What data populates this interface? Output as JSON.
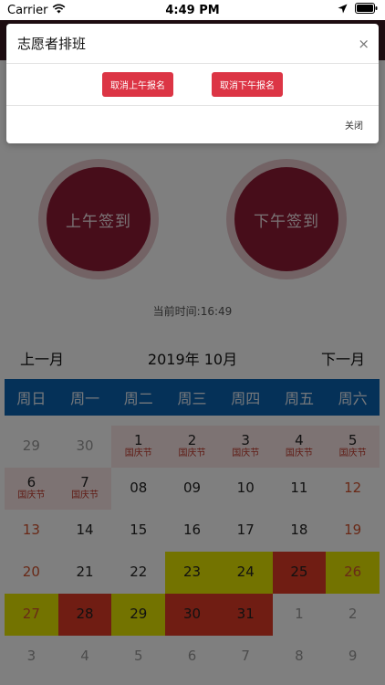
{
  "status_bar": {
    "carrier": "Carrier",
    "time": "4:49 PM"
  },
  "modal": {
    "title": "志愿者排班",
    "close_symbol": "×",
    "cancel_morning": "取消上午报名",
    "cancel_afternoon": "取消下午报名",
    "footer_close": "关闭"
  },
  "page": {
    "morning_sign": "上午签到",
    "afternoon_sign": "下午签到",
    "current_time": "当前时间:16:49",
    "prev_month": "上一月",
    "month_label": "2019年 10月",
    "next_month": "下一月"
  },
  "calendar": {
    "weekdays": [
      "周日",
      "周一",
      "周二",
      "周三",
      "周四",
      "周五",
      "周六"
    ],
    "colors": {
      "weekday_bar": "#0a63b0",
      "yellow": "#e6e600",
      "red": "#e03a26",
      "holiday_bg": "#fae6e6"
    },
    "days": [
      {
        "day": "29",
        "sub": "",
        "type": "other"
      },
      {
        "day": "30",
        "sub": "",
        "type": "other"
      },
      {
        "day": "1",
        "sub": "国庆节",
        "type": "holiday"
      },
      {
        "day": "2",
        "sub": "国庆节",
        "type": "holiday"
      },
      {
        "day": "3",
        "sub": "国庆节",
        "type": "holiday"
      },
      {
        "day": "4",
        "sub": "国庆节",
        "type": "holiday"
      },
      {
        "day": "5",
        "sub": "国庆节",
        "type": "holiday"
      },
      {
        "day": "6",
        "sub": "国庆节",
        "type": "holiday"
      },
      {
        "day": "7",
        "sub": "国庆节",
        "type": "holiday"
      },
      {
        "day": "08",
        "sub": "",
        "type": "normal"
      },
      {
        "day": "09",
        "sub": "",
        "type": "normal"
      },
      {
        "day": "10",
        "sub": "",
        "type": "normal"
      },
      {
        "day": "11",
        "sub": "",
        "type": "normal"
      },
      {
        "day": "12",
        "sub": "",
        "type": "weekend"
      },
      {
        "day": "13",
        "sub": "",
        "type": "weekend"
      },
      {
        "day": "14",
        "sub": "",
        "type": "normal"
      },
      {
        "day": "15",
        "sub": "",
        "type": "normal"
      },
      {
        "day": "16",
        "sub": "",
        "type": "normal"
      },
      {
        "day": "17",
        "sub": "",
        "type": "normal"
      },
      {
        "day": "18",
        "sub": "",
        "type": "normal"
      },
      {
        "day": "19",
        "sub": "",
        "type": "weekend"
      },
      {
        "day": "20",
        "sub": "",
        "type": "weekend"
      },
      {
        "day": "21",
        "sub": "",
        "type": "normal"
      },
      {
        "day": "22",
        "sub": "",
        "type": "normal"
      },
      {
        "day": "23",
        "sub": "",
        "type": "yellow"
      },
      {
        "day": "24",
        "sub": "",
        "type": "yellow"
      },
      {
        "day": "25",
        "sub": "",
        "type": "red"
      },
      {
        "day": "26",
        "sub": "",
        "type": "yellow-weekend"
      },
      {
        "day": "27",
        "sub": "",
        "type": "yellow-weekend"
      },
      {
        "day": "28",
        "sub": "",
        "type": "red"
      },
      {
        "day": "29",
        "sub": "",
        "type": "yellow"
      },
      {
        "day": "30",
        "sub": "",
        "type": "red"
      },
      {
        "day": "31",
        "sub": "",
        "type": "red"
      },
      {
        "day": "1",
        "sub": "",
        "type": "other"
      },
      {
        "day": "2",
        "sub": "",
        "type": "other"
      },
      {
        "day": "3",
        "sub": "",
        "type": "other"
      },
      {
        "day": "4",
        "sub": "",
        "type": "other"
      },
      {
        "day": "5",
        "sub": "",
        "type": "other"
      },
      {
        "day": "6",
        "sub": "",
        "type": "other"
      },
      {
        "day": "7",
        "sub": "",
        "type": "other"
      },
      {
        "day": "8",
        "sub": "",
        "type": "other"
      },
      {
        "day": "9",
        "sub": "",
        "type": "other"
      }
    ]
  }
}
